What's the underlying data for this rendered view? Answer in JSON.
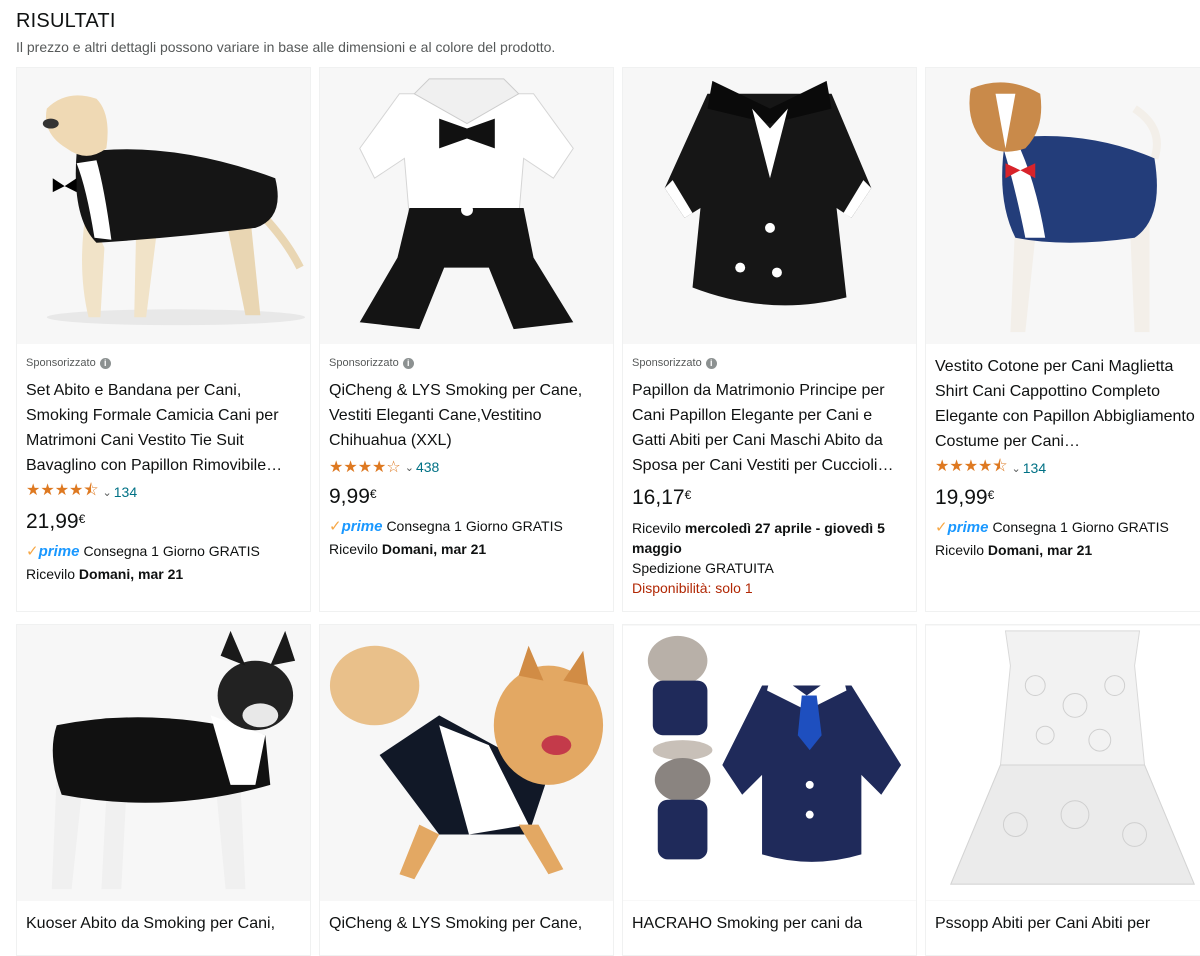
{
  "header": {
    "title": "RISULTATI",
    "subtitle": "Il prezzo e altri dettagli possono variare in base alle dimensioni e al colore del prodotto."
  },
  "products": [
    {
      "sponsored": "Sponsorizzato",
      "title": "Set Abito e Bandana per Cani, Smoking Formale Camicia Cani per Matrimoni Cani Vestito Tie Suit Bavaglino con Papillon Rimovibile…",
      "stars": "★★★★⯪",
      "reviews": "134",
      "price_whole": "21,99",
      "price_currency": "€",
      "prime_text": "prime",
      "delivery_text": "Consegna 1 Giorno GRATIS",
      "receive_prefix": "Ricevilo",
      "receive_date": "Domani, mar 21"
    },
    {
      "sponsored": "Sponsorizzato",
      "title": "QiCheng & LYS Smoking per Cane, Vestiti Eleganti Cane,Vestitino Chihuahua (XXL)",
      "stars": "★★★★☆",
      "reviews": "438",
      "price_whole": "9,99",
      "price_currency": "€",
      "prime_text": "prime",
      "delivery_text": "Consegna 1 Giorno GRATIS",
      "receive_prefix": "Ricevilo",
      "receive_date": "Domani, mar 21"
    },
    {
      "sponsored": "Sponsorizzato",
      "title": "Papillon da Matrimonio Principe per Cani Papillon Elegante per Cani e Gatti Abiti per Cani Maschi Abito da Sposa per Cani Vestiti per Cuccioli…",
      "price_whole": "16,17",
      "price_currency": "€",
      "receive_prefix": "Ricevilo",
      "receive_date": "mercoledì 27 aprile - giovedì 5 maggio",
      "shipping": "Spedizione GRATUITA",
      "availability": "Disponibilità: solo 1"
    },
    {
      "title": "Vestito Cotone per Cani Maglietta Shirt Cani Cappottino Completo Elegante con Papillon Abbigliamento Costume per Cani…",
      "stars": "★★★★⯪",
      "reviews": "134",
      "price_whole": "19,99",
      "price_currency": "€",
      "prime_text": "prime",
      "delivery_text": "Consegna 1 Giorno GRATIS",
      "receive_prefix": "Ricevilo",
      "receive_date": "Domani, mar 21"
    },
    {
      "title": "Kuoser Abito da Smoking per Cani,"
    },
    {
      "title": "QiCheng & LYS Smoking per Cane,"
    },
    {
      "title": "HACRAHO Smoking per cani da"
    },
    {
      "title": "Pssopp Abiti per Cani Abiti per"
    }
  ]
}
